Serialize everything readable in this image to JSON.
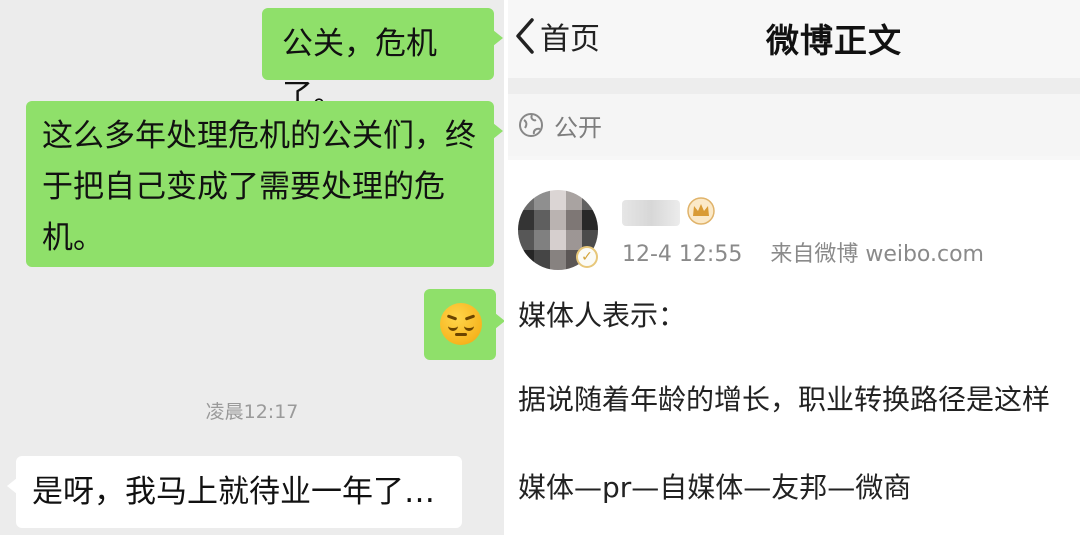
{
  "chat": {
    "messages": [
      {
        "direction": "out",
        "text": "公关，危机了。"
      },
      {
        "direction": "out",
        "lines": [
          "这么多年处理危机的公关们，终",
          "于把自己变成了需要处理的危",
          "机。"
        ]
      },
      {
        "direction": "out",
        "emoji": "pensive-face"
      },
      {
        "direction": "in",
        "text": "是呀，我马上就待业一年了…"
      }
    ],
    "timestamp": "凌晨12:17",
    "colors": {
      "outgoing_bubble": "#8fe06a",
      "incoming_bubble": "#ffffff",
      "background": "#ececec"
    }
  },
  "weibo": {
    "nav": {
      "back_label": "首页",
      "title": "微博正文"
    },
    "visibility": "公开",
    "post": {
      "time": "12-4 12:55",
      "source": "来自微博 weibo.com",
      "paragraphs": [
        "媒体人表示：",
        "据说随着年龄的增长，职业转换路径是这样",
        "媒体—pr—自媒体—友邦—微商"
      ]
    }
  }
}
